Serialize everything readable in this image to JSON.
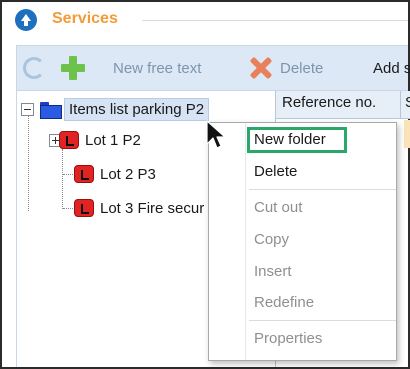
{
  "window": {
    "title": "Services",
    "title_color": "#f29b38"
  },
  "toolbar": {
    "refresh_icon": "refresh-icon",
    "new_free_text_label": "New free text",
    "delete_label": "Delete",
    "add_label": "Add s"
  },
  "tree": {
    "root": {
      "label": "Items list parking P2",
      "icon": "folder-icon",
      "expanded": true
    },
    "children": [
      {
        "label": "Lot 1 P2",
        "icon": "lot-icon",
        "expandable": true
      },
      {
        "label": "Lot 2 P3",
        "icon": "lot-icon",
        "expandable": false
      },
      {
        "label": "Lot 3 Fire secur",
        "icon": "lot-icon",
        "expandable": false
      }
    ]
  },
  "grid": {
    "columns": [
      "Reference no.",
      "S"
    ]
  },
  "context_menu": {
    "items": [
      {
        "label": "New folder",
        "enabled": true,
        "highlighted": true
      },
      {
        "label": "Delete",
        "enabled": true
      },
      {
        "label": "Cut out",
        "enabled": false
      },
      {
        "label": "Copy",
        "enabled": false
      },
      {
        "label": "Insert",
        "enabled": false
      },
      {
        "label": "Redefine",
        "enabled": false
      },
      {
        "label": "Properties",
        "enabled": false
      }
    ],
    "highlight_color": "#2aa86b"
  }
}
